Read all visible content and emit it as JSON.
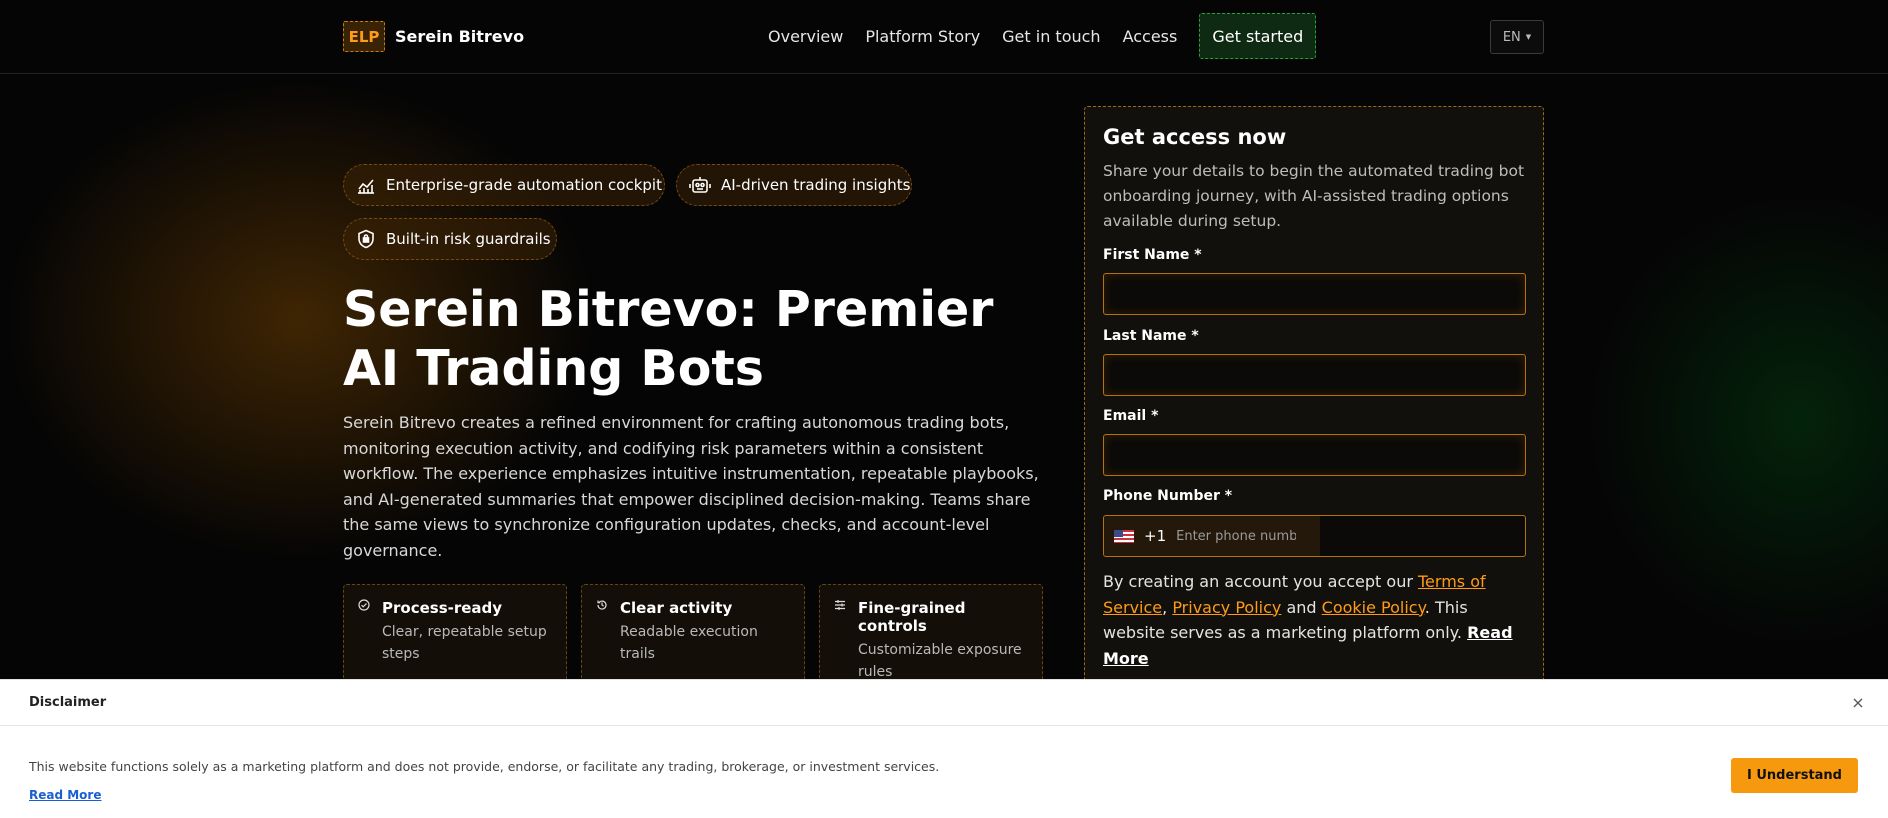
{
  "header": {
    "logo_badge": "ELP",
    "brand": "Serein Bitrevo",
    "nav": [
      "Overview",
      "Platform Story",
      "Get in touch",
      "Access"
    ],
    "cta": "Get started",
    "language": "EN"
  },
  "pills": [
    {
      "label": "Enterprise-grade automation cockpit",
      "icon": "chart-line-icon"
    },
    {
      "label": "AI-driven trading insights",
      "icon": "robot-icon"
    },
    {
      "label": "Built-in risk guardrails",
      "icon": "shield-lock-icon"
    }
  ],
  "hero": {
    "title": "Serein Bitrevo: Premier AI Trading Bots",
    "description": "Serein Bitrevo creates a refined environment for crafting autonomous trading bots, monitoring execution activity, and codifying risk parameters within a consistent workflow. The experience emphasizes intuitive instrumentation, repeatable playbooks, and AI-generated summaries that empower disciplined decision-making. Teams share the same views to synchronize configuration updates, checks, and account-level governance."
  },
  "features": [
    {
      "title": "Process-ready",
      "subtitle": "Clear, repeatable setup steps",
      "icon": "check-circle-icon"
    },
    {
      "title": "Clear activity",
      "subtitle": "Readable execution trails",
      "icon": "history-icon"
    },
    {
      "title": "Fine-grained controls",
      "subtitle": "Customizable exposure rules",
      "icon": "sliders-icon"
    }
  ],
  "form": {
    "title": "Get access now",
    "subtitle": "Share your details to begin the automated trading bot onboarding journey, with AI-assisted trading options available during setup.",
    "first_name_label": "First Name *",
    "last_name_label": "Last Name *",
    "email_label": "Email *",
    "phone_label": "Phone Number *",
    "phone_dial_code": "+1",
    "phone_placeholder": "Enter phone number",
    "terms_prefix": "By creating an account you accept our ",
    "terms_link": "Terms of Service",
    "comma": ", ",
    "privacy_link": "Privacy Policy",
    "and": " and ",
    "cookie_link": "Cookie Policy",
    "terms_suffix": ". This website serves as a marketing platform only. ",
    "read_more": "Read More"
  },
  "disclaimer": {
    "title": "Disclaimer",
    "close": "×",
    "text": "This website functions solely as a marketing platform and does not provide, endorse, or facilitate any trading, brokerage, or investment services.",
    "read_more": "Read More",
    "button": "I Understand"
  },
  "colors": {
    "accent": "#f6990f",
    "cta_green": "#25a33a",
    "background": "#050505"
  }
}
